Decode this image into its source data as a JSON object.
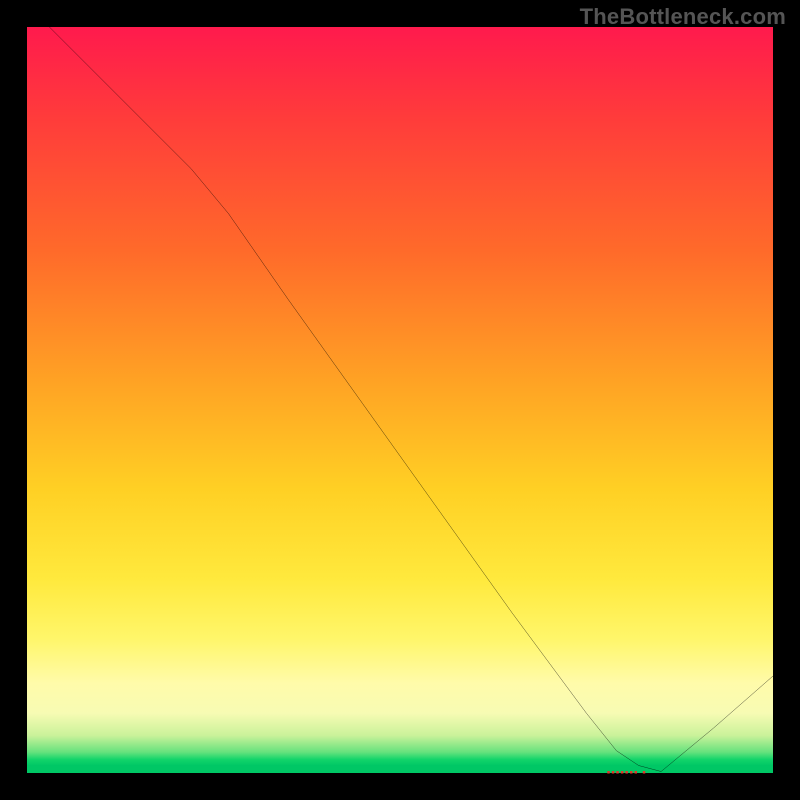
{
  "watermark": "TheBottleneck.com",
  "chart_data": {
    "type": "line",
    "title": "",
    "xlabel": "",
    "ylabel": "",
    "xlim": [
      0,
      100
    ],
    "ylim": [
      0,
      100
    ],
    "x": [
      0,
      3,
      8,
      15,
      22,
      27,
      35,
      45,
      55,
      65,
      75,
      79,
      82,
      85,
      92,
      100
    ],
    "values": [
      102,
      100,
      95,
      88,
      81,
      75,
      63.5,
      49.5,
      35.5,
      21.5,
      8,
      3,
      1,
      0.2,
      6,
      13
    ],
    "background_gradient": {
      "orientation": "vertical",
      "stops": [
        {
          "pos": 0.0,
          "color": "#ff1a4d"
        },
        {
          "pos": 0.3,
          "color": "#ff6a2a"
        },
        {
          "pos": 0.62,
          "color": "#ffd024"
        },
        {
          "pos": 0.88,
          "color": "#fffbaa"
        },
        {
          "pos": 0.98,
          "color": "#12d46a"
        },
        {
          "pos": 1.0,
          "color": "#00c765"
        }
      ]
    },
    "x_marker": {
      "pos": 82,
      "glyphs": "▪▪▪▪▪▪▪ ▪"
    }
  }
}
